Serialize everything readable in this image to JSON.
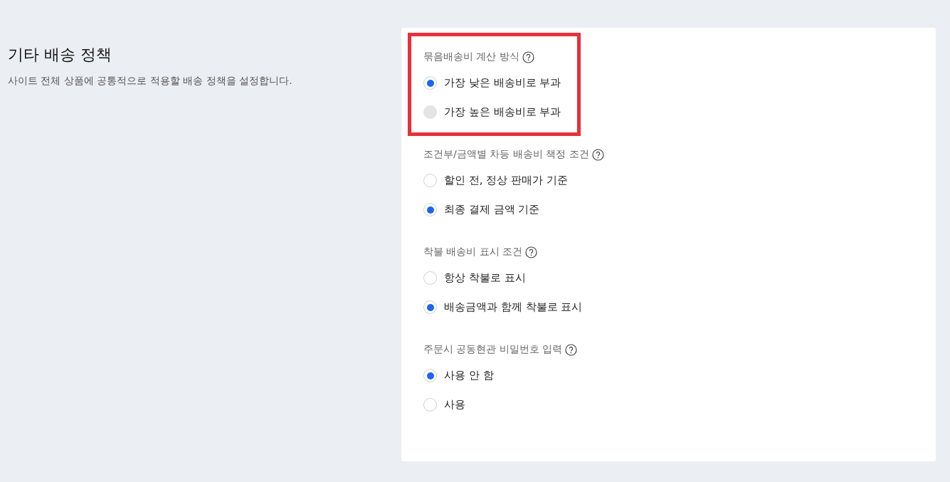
{
  "section": {
    "title": "기타 배송 정책",
    "description": "사이트 전체 상품에 공통적으로 적용할 배송 정책을 설정합니다."
  },
  "groups": [
    {
      "label": "묶음배송비 계산 방식",
      "highlighted": true,
      "options": [
        {
          "label": "가장 낮은 배송비로 부과",
          "selected": true,
          "disabled": false
        },
        {
          "label": "가장 높은 배송비로 부과",
          "selected": false,
          "disabled": true
        }
      ]
    },
    {
      "label": "조건부/금액별 차등 배송비 책정 조건",
      "highlighted": false,
      "options": [
        {
          "label": "할인 전, 정상 판매가 기준",
          "selected": false,
          "disabled": false
        },
        {
          "label": "최종 결제 금액 기준",
          "selected": true,
          "disabled": false
        }
      ]
    },
    {
      "label": "착불 배송비 표시 조건",
      "highlighted": false,
      "options": [
        {
          "label": "항상 착불로 표시",
          "selected": false,
          "disabled": false
        },
        {
          "label": "배송금액과 함께 착불로 표시",
          "selected": true,
          "disabled": false
        }
      ]
    },
    {
      "label": "주문시 공동현관 비밀번호 입력",
      "highlighted": false,
      "options": [
        {
          "label": "사용 안 함",
          "selected": true,
          "disabled": false
        },
        {
          "label": "사용",
          "selected": false,
          "disabled": false
        }
      ]
    }
  ]
}
